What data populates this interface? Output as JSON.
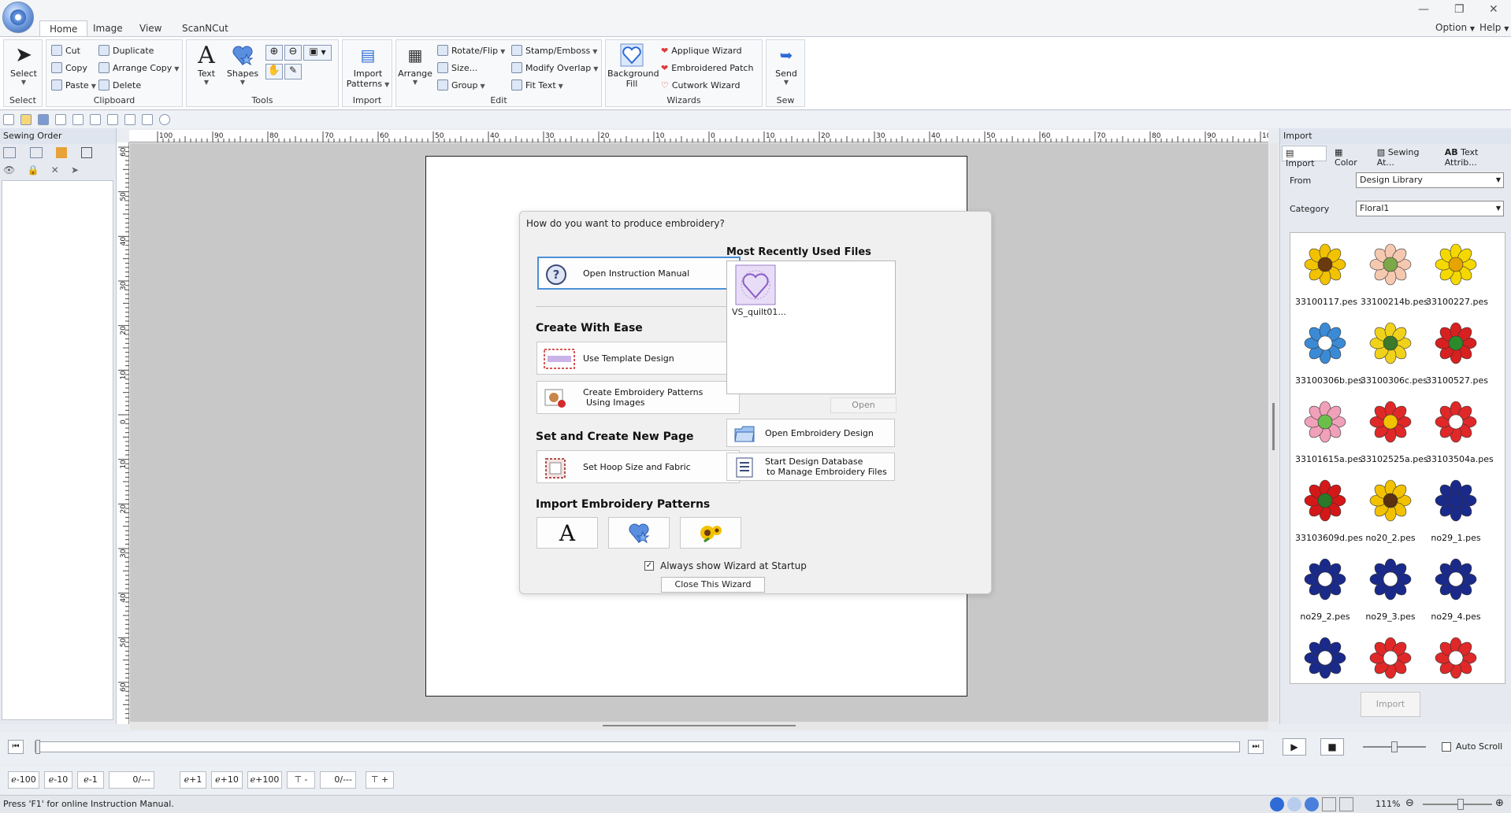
{
  "tabs": [
    "Home",
    "Image",
    "View",
    "ScanNCut"
  ],
  "topright": {
    "option": "Option",
    "help": "Help"
  },
  "ribbon": {
    "select": {
      "button": "Select",
      "group": "Select"
    },
    "clipboard": {
      "cut": "Cut",
      "copy": "Copy",
      "paste": "Paste",
      "duplicate": "Duplicate",
      "arrange_copy": "Arrange Copy",
      "delete": "Delete",
      "group": "Clipboard"
    },
    "tools": {
      "text": "Text",
      "shapes": "Shapes",
      "group": "Tools"
    },
    "import": {
      "button_line1": "Import",
      "button_line2": "Patterns",
      "group": "Import"
    },
    "edit": {
      "arrange": "Arrange",
      "rotate": "Rotate/Flip",
      "size": "Size...",
      "group_btn": "Group",
      "stamp": "Stamp/Emboss",
      "modify": "Modify Overlap",
      "fit_text": "Fit Text",
      "group": "Edit"
    },
    "wizards": {
      "bg_line1": "Background",
      "bg_line2": "Fill",
      "applique": "Applique Wizard",
      "patch": "Embroidered Patch",
      "cutwork": "Cutwork Wizard",
      "group": "Wizards"
    },
    "sew": {
      "send": "Send",
      "group": "Sew"
    }
  },
  "left_panel": {
    "title": "Sewing Order"
  },
  "ruler": {
    "h_ticks": [
      "100",
      "90",
      "80",
      "70",
      "60",
      "50",
      "40",
      "30",
      "20",
      "10",
      "0",
      "10",
      "20",
      "30",
      "40",
      "50",
      "60",
      "70",
      "80",
      "90",
      "100"
    ],
    "v_ticks": [
      "60",
      "50",
      "40",
      "30",
      "20",
      "10",
      "0",
      "10",
      "20",
      "30",
      "40",
      "50",
      "60"
    ]
  },
  "wizard": {
    "question": "How do you want to produce embroidery?",
    "manual": "Open Instruction Manual",
    "create_heading": "Create With Ease",
    "template": "Use Template Design",
    "images_line1": "Create Embroidery Patterns",
    "images_line2": "Using Images",
    "set_heading": "Set and Create New Page",
    "hoop": "Set Hoop Size and Fabric",
    "import_heading": "Import Embroidery Patterns",
    "mru_heading": "Most Recently Used Files",
    "mru_files": [
      "VS_quilt01..."
    ],
    "open": "Open",
    "open_design": "Open Embroidery Design",
    "db_line1": "Start Design Database",
    "db_line2": "to Manage Embroidery Files",
    "always_show": "Always show Wizard at Startup",
    "close": "Close This Wizard",
    "icons": {
      "text_icon": "A"
    }
  },
  "right_panel": {
    "title": "Import",
    "tabs": [
      "Import",
      "Color",
      "Sewing At...",
      "Text Attrib..."
    ],
    "from_label": "From",
    "from_value": "Design Library",
    "category_label": "Category",
    "category_value": "Floral1",
    "import_button": "Import",
    "designs": [
      {
        "name": "33100117.pes",
        "color": "#f2c200",
        "center": "#6b3a10"
      },
      {
        "name": "33100214b.pes",
        "color": "#f5c8b0",
        "center": "#7da84a"
      },
      {
        "name": "33100227.pes",
        "color": "#f5d800",
        "center": "#e6a400"
      },
      {
        "name": "33100306b.pes",
        "color": "#3b8ad6",
        "center": "#ffffff"
      },
      {
        "name": "33100306c.pes",
        "color": "#f0d21a",
        "center": "#3a7a2a"
      },
      {
        "name": "33100527.pes",
        "color": "#d82020",
        "center": "#2b8a2b"
      },
      {
        "name": "33101615a.pes",
        "color": "#f0a0b8",
        "center": "#6abf4a"
      },
      {
        "name": "33102525a.pes",
        "color": "#e02828",
        "center": "#f2c200"
      },
      {
        "name": "33103504a.pes",
        "color": "#e02828",
        "center": "#ffffff"
      },
      {
        "name": "33103609d.pes",
        "color": "#d41818",
        "center": "#2a7a2a"
      },
      {
        "name": "no20_2.pes",
        "color": "#f2c200",
        "center": "#5a3210"
      },
      {
        "name": "no29_1.pes",
        "color": "#1a2a8a",
        "center": "#1a2a8a"
      },
      {
        "name": "no29_2.pes",
        "color": "#1a2a8a",
        "center": "#ffffff"
      },
      {
        "name": "no29_3.pes",
        "color": "#1a2a8a",
        "center": "#ffffff"
      },
      {
        "name": "no29_4.pes",
        "color": "#1a2a8a",
        "center": "#ffffff"
      },
      {
        "name": "",
        "color": "#1a2a8a",
        "center": "#ffffff"
      },
      {
        "name": "",
        "color": "#e02828",
        "center": "#ffffff"
      },
      {
        "name": "",
        "color": "#e02828",
        "center": "#ffffff"
      }
    ]
  },
  "steps": {
    "m100": "-100",
    "m10": "-10",
    "m1": "-1",
    "p1": "+1",
    "p10": "+10",
    "p100": "+100",
    "value1": "0/---",
    "value2": "0/---",
    "minus": "-",
    "plus": "+"
  },
  "timeline": {
    "auto_scroll": "Auto Scroll"
  },
  "status": {
    "text": "Press 'F1' for online Instruction Manual.",
    "zoom": "111%"
  },
  "colors": {
    "accent": "#2d6bd6",
    "ribbon_bg": "#ffffff",
    "canvas_bg": "#c8c8c8"
  }
}
